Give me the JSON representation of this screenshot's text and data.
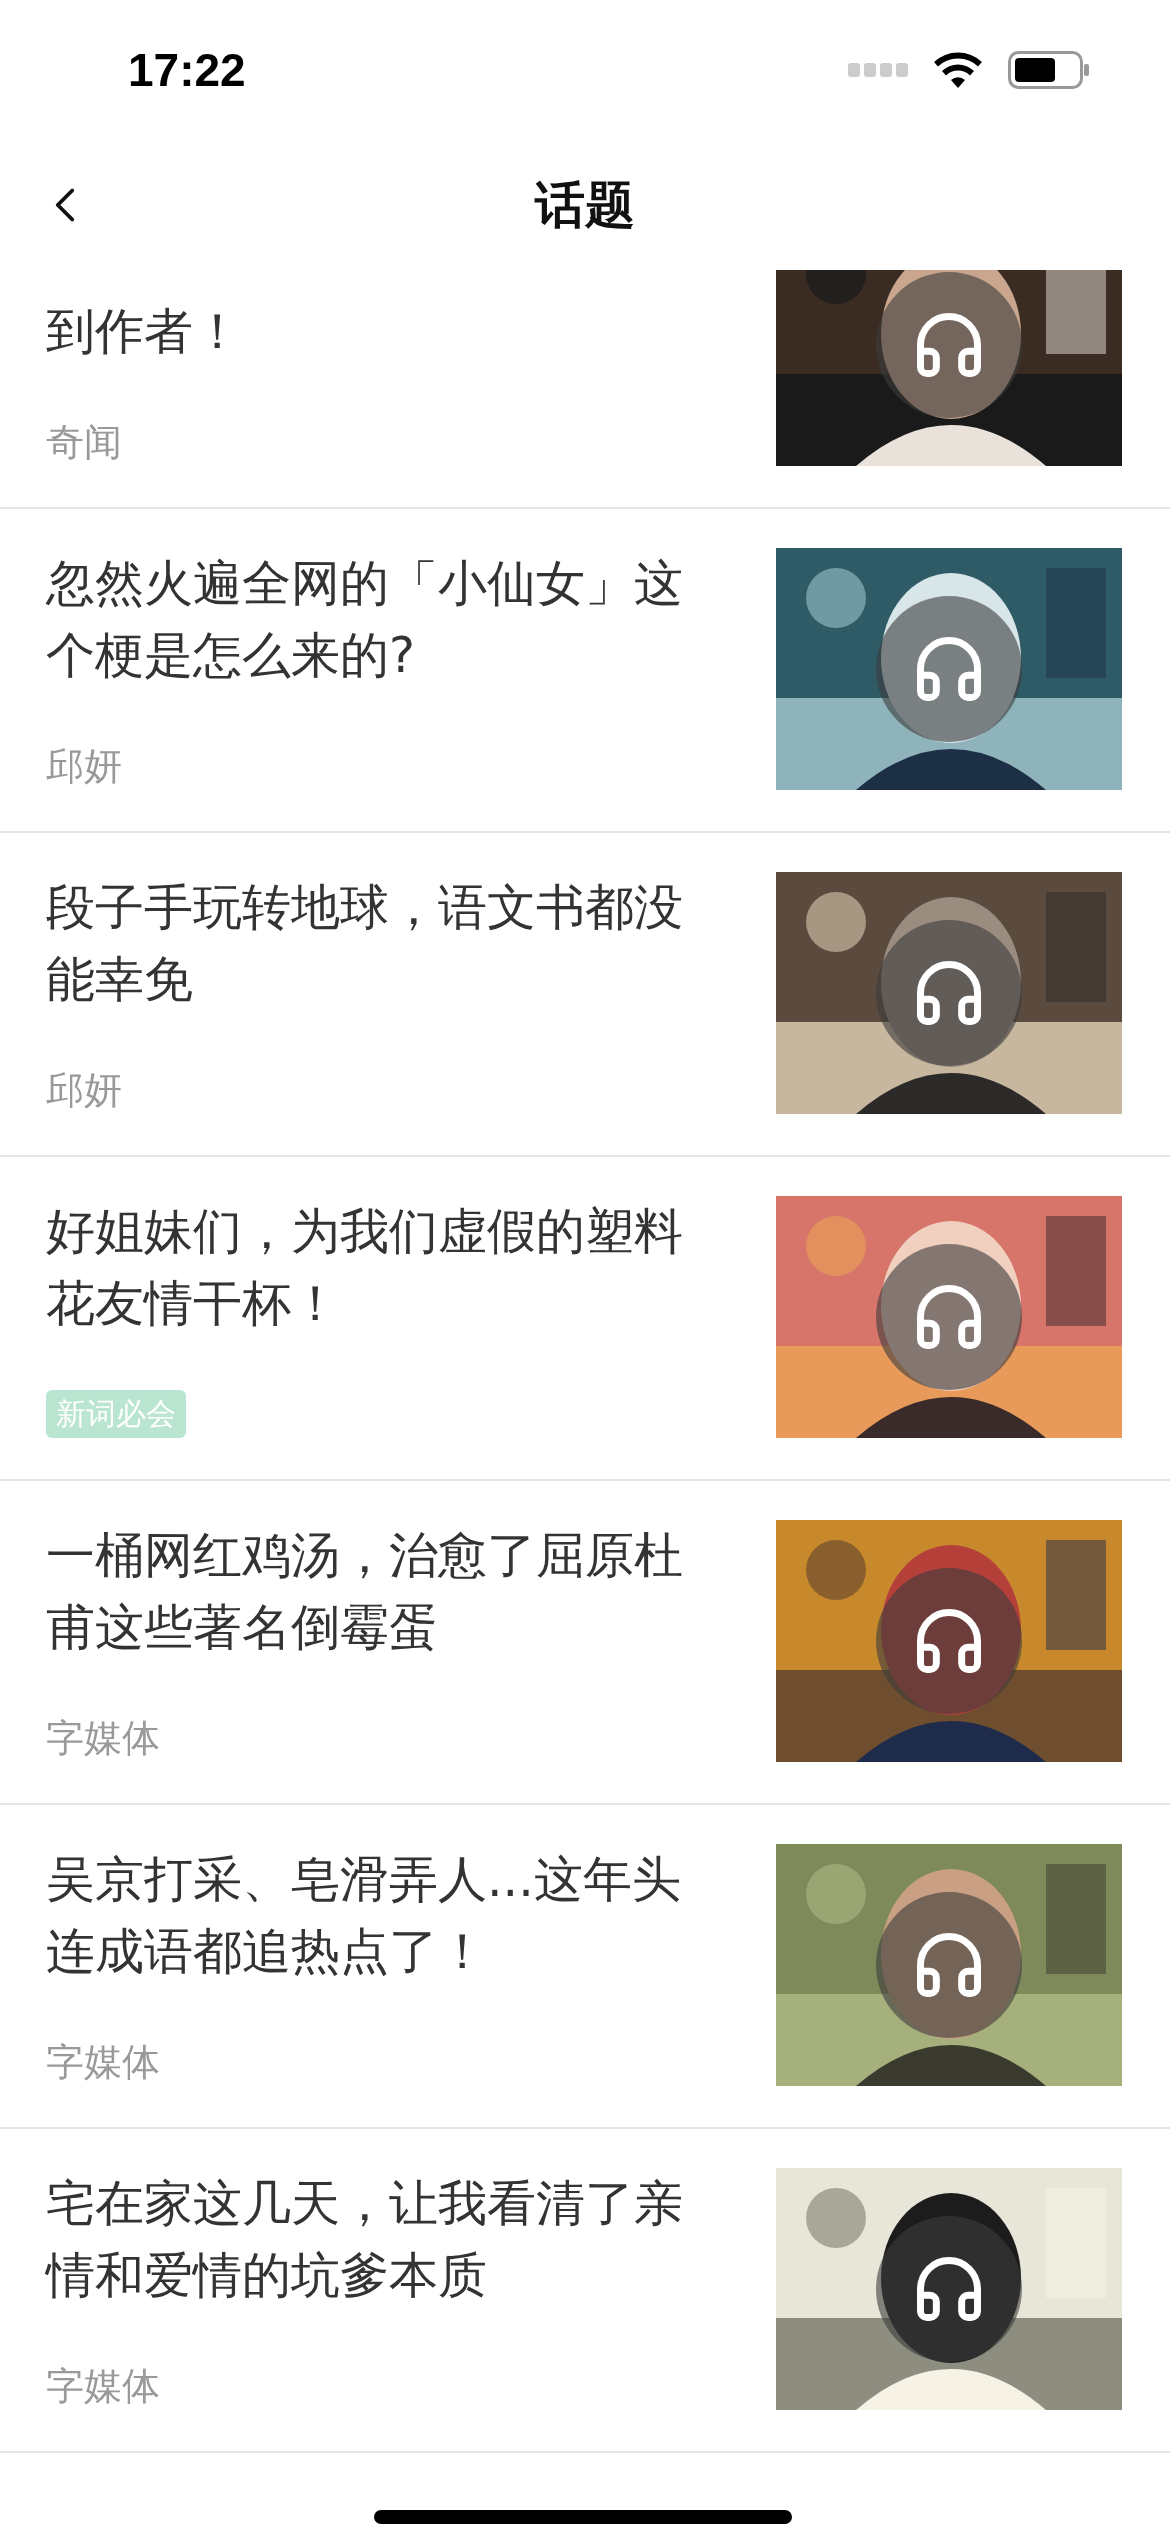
{
  "status_bar": {
    "time": "17:22"
  },
  "nav": {
    "title": "话题"
  },
  "items": [
    {
      "title": "到作者！",
      "label": {
        "kind": "category",
        "text": "奇闻"
      }
    },
    {
      "title": "忽然火遍全网的「小仙女」这个梗是怎么来的?",
      "label": {
        "kind": "category",
        "text": "邱妍"
      }
    },
    {
      "title": "段子手玩转地球，语文书都没能幸免",
      "label": {
        "kind": "category",
        "text": "邱妍"
      }
    },
    {
      "title": "好姐妹们，为我们虚假的塑料花友情干杯！",
      "label": {
        "kind": "tag",
        "text": "新词必会"
      }
    },
    {
      "title": "一桶网红鸡汤，治愈了屈原杜甫这些著名倒霉蛋",
      "label": {
        "kind": "category",
        "text": "字媒体"
      }
    },
    {
      "title": "吴京打采、皂滑弄人...这年头连成语都追热点了！",
      "label": {
        "kind": "category",
        "text": "字媒体"
      }
    },
    {
      "title": "宅在家这几天，让我看清了亲情和爱情的坑爹本质",
      "label": {
        "kind": "category",
        "text": "字媒体"
      }
    }
  ]
}
